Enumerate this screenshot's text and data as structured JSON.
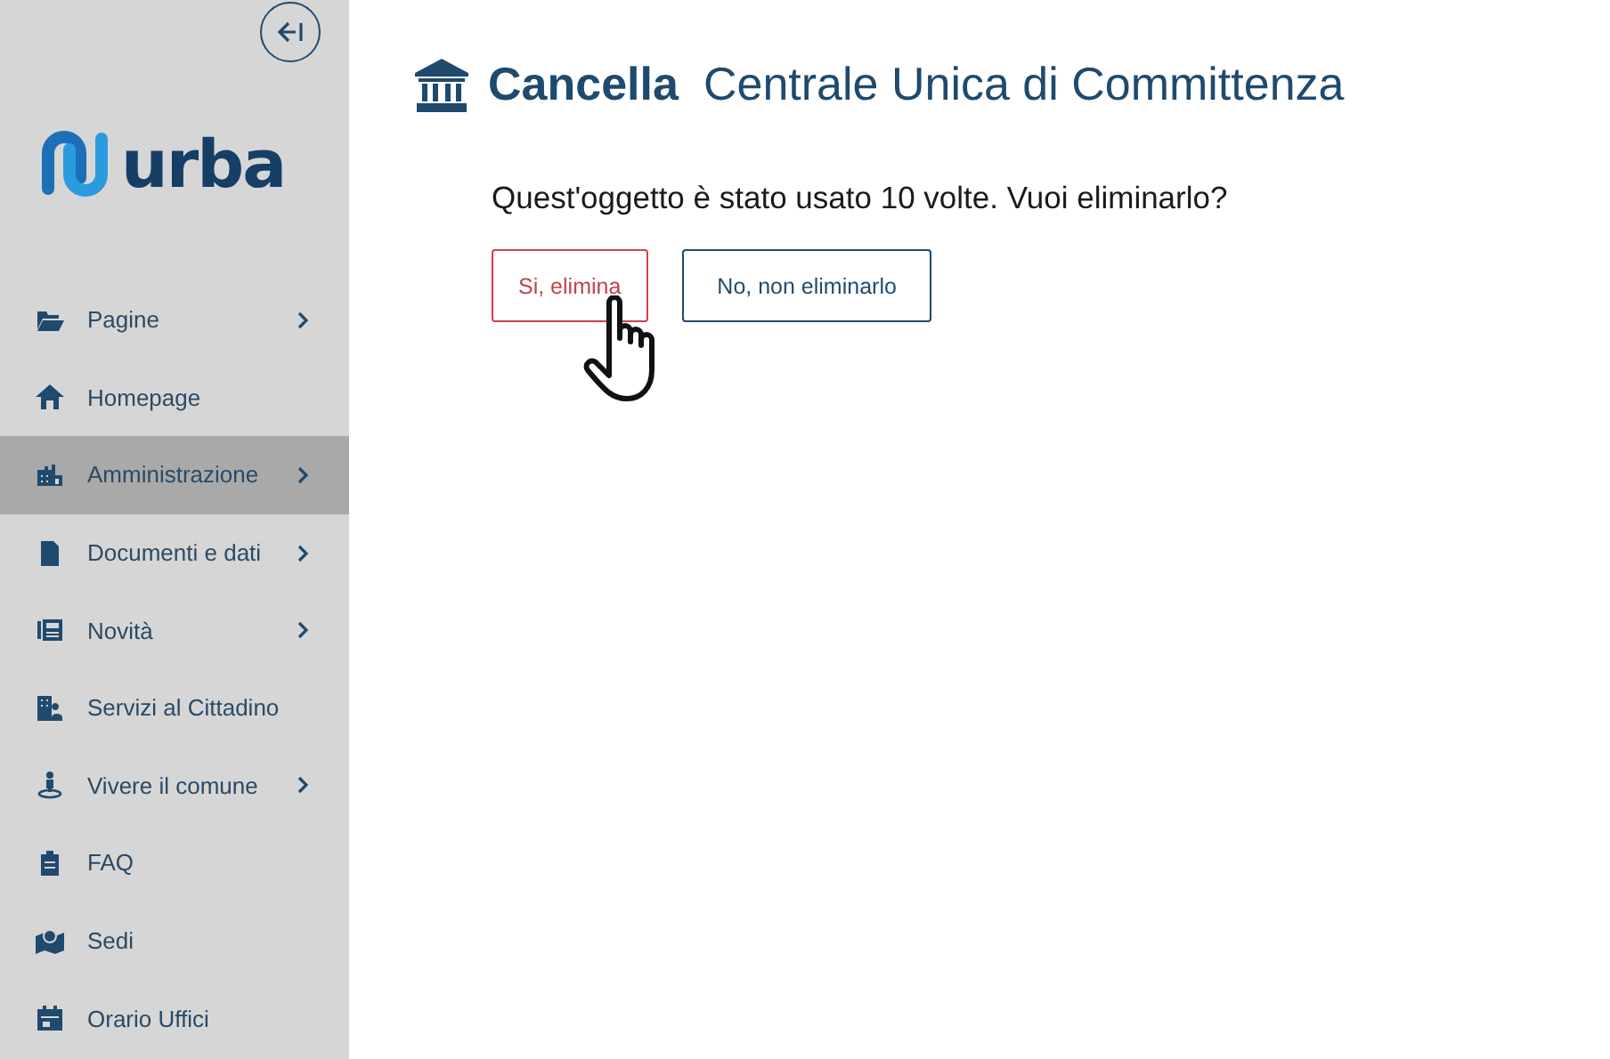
{
  "brand": {
    "name": "urba"
  },
  "sidebar": {
    "items": [
      {
        "label": "Pagine",
        "selected": false,
        "expandable": true
      },
      {
        "label": "Homepage",
        "selected": false,
        "expandable": false
      },
      {
        "label": "Amministrazione",
        "selected": true,
        "expandable": true
      },
      {
        "label": "Documenti e dati",
        "selected": false,
        "expandable": true
      },
      {
        "label": "Novità",
        "selected": false,
        "expandable": true
      },
      {
        "label": "Servizi al Cittadino",
        "selected": false,
        "expandable": false
      },
      {
        "label": "Vivere il comune",
        "selected": false,
        "expandable": true
      },
      {
        "label": "FAQ",
        "selected": false,
        "expandable": false
      },
      {
        "label": "Sedi",
        "selected": false,
        "expandable": false
      },
      {
        "label": "Orario Uffici",
        "selected": false,
        "expandable": false
      }
    ]
  },
  "header": {
    "action": "Cancella",
    "title": "Centrale Unica di Committenza"
  },
  "question": "Quest'oggetto è stato usato 10 volte. Vuoi eliminarlo?",
  "buttons": [
    {
      "label": "Si, elimina",
      "kind": "danger"
    },
    {
      "label": "No, non eliminarlo",
      "kind": "primary"
    }
  ]
}
